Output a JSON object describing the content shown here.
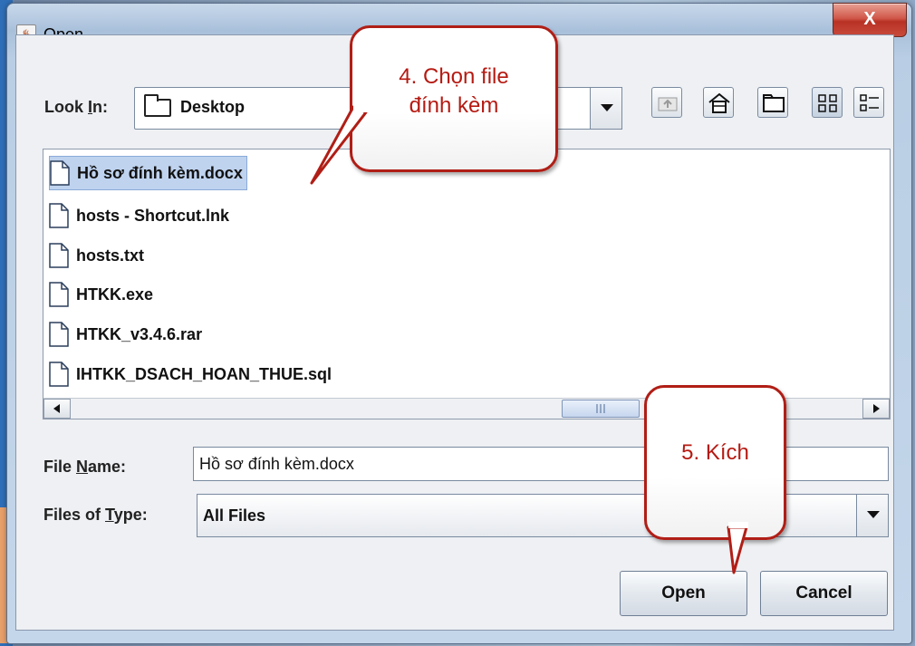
{
  "window": {
    "title": "Open",
    "close_label": "X"
  },
  "look_in": {
    "label_prefix": "Look ",
    "label_mnemonic": "I",
    "label_suffix": "n:",
    "value": "Desktop"
  },
  "files": [
    "Hồ sơ đính kèm.docx",
    "hosts - Shortcut.lnk",
    "hosts.txt",
    "HTKK.exe",
    "HTKK_v3.4.6.rar",
    "IHTKK_DSACH_HOAN_THUE.sql"
  ],
  "selected_file_index": 0,
  "file_name": {
    "label_prefix": "File ",
    "label_mnemonic": "N",
    "label_suffix": "ame:",
    "value": "Hồ sơ đính kèm.docx"
  },
  "file_type": {
    "label_prefix": "Files of ",
    "label_mnemonic": "T",
    "label_suffix": "ype:",
    "value": "All Files"
  },
  "buttons": {
    "open": "Open",
    "cancel": "Cancel"
  },
  "callouts": {
    "step4_line1": "4. Chọn file",
    "step4_line2": "đính kèm",
    "step5": "5. Kích"
  },
  "colors": {
    "callout_border": "#b01e16",
    "callout_text": "#b51a12",
    "selection": "#bfd3ef"
  }
}
